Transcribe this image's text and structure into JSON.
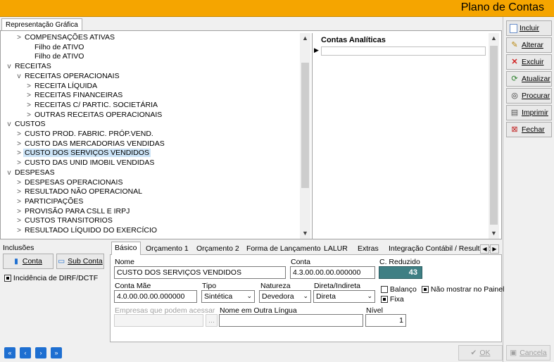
{
  "window": {
    "title": "Plano de Contas"
  },
  "main_tab": {
    "label": "Representação Gráfica"
  },
  "tree": {
    "rows": [
      {
        "label": "COMPENSAÇÕES ATIVAS",
        "chev": ">"
      },
      {
        "label": "Filho de ATIVO",
        "chev": ""
      },
      {
        "label": "Filho de ATIVO",
        "chev": ""
      },
      {
        "label": "RECEITAS",
        "chev": "v"
      },
      {
        "label": "RECEITAS OPERACIONAIS",
        "chev": "v"
      },
      {
        "label": "RECEITA LÍQUIDA",
        "chev": ">"
      },
      {
        "label": "RECEITAS FINANCEIRAS",
        "chev": ">"
      },
      {
        "label": "RECEITAS C/ PARTIC. SOCIETÁRIA",
        "chev": ">"
      },
      {
        "label": "OUTRAS RECEITAS OPERACIONAIS",
        "chev": ">"
      },
      {
        "label": "CUSTOS",
        "chev": "v"
      },
      {
        "label": "CUSTO PROD. FABRIC. PRÓP.VEND.",
        "chev": ">"
      },
      {
        "label": "CUSTO DAS MERCADORIAS VENDIDAS",
        "chev": ">"
      },
      {
        "label": "CUSTO DOS SERVIÇOS VENDIDOS",
        "chev": ">"
      },
      {
        "label": "CUSTO DAS UNID IMOBIL VENDIDAS",
        "chev": ">"
      },
      {
        "label": "DESPESAS",
        "chev": "v"
      },
      {
        "label": "DESPESAS OPERACIONAIS",
        "chev": ">"
      },
      {
        "label": "RESULTADO NÃO OPERACIONAL",
        "chev": ">"
      },
      {
        "label": "PARTICIPAÇÕES",
        "chev": ">"
      },
      {
        "label": "PROVISÃO PARA CSLL E IRPJ",
        "chev": ">"
      },
      {
        "label": "CUSTOS TRANSITORIOS",
        "chev": ">"
      },
      {
        "label": "RESULTADO LÍQUIDO DO EXERCÍCIO",
        "chev": ">"
      }
    ],
    "selected_label": "CUSTO DOS SERVIÇOS VENDIDOS"
  },
  "contas_panel": {
    "header": "Contas Analíticas"
  },
  "sidebar": {
    "incluir": "Incluir",
    "alterar": "Alterar",
    "excluir": "Excluir",
    "atualizar": "Atualizar",
    "procurar": "Procurar",
    "imprimir": "Imprimir",
    "fechar": "Fechar"
  },
  "inclusoes": {
    "label": "Inclusões",
    "conta_button": "Conta",
    "subconta_button": "Sub Conta",
    "dirf_label": "Incidência de DIRF/DCTF",
    "dirf_checked": true
  },
  "form_tabs": [
    "Básico",
    "Orçamento 1",
    "Orçamento 2",
    "Forma de Lançamento",
    "LALUR",
    "Extras",
    "Integração Contábil / Resultado"
  ],
  "form": {
    "nome_label": "Nome",
    "nome_value": "CUSTO DOS SERVIÇOS VENDIDOS",
    "conta_label": "Conta",
    "conta_value": "4.3.00.00.00.000000",
    "creduzido_label": "C. Reduzido",
    "creduzido_value": "43",
    "contamae_label": "Conta Mãe",
    "contamae_value": "4.0.00.00.00.000000",
    "tipo_label": "Tipo",
    "tipo_value": "Sintética",
    "natureza_label": "Natureza",
    "natureza_value": "Devedora",
    "direta_label": "Direta/Indireta",
    "direta_value": "Direta",
    "balanco_label": "Balanço",
    "balanco_checked": false,
    "fixa_label": "Fixa",
    "fixa_checked": true,
    "naomostrar_label": "Não mostrar no Painel",
    "naomostrar_checked": true,
    "empresas_label": "Empresas que podem acessar",
    "empresas_button": "...",
    "nomeoutra_label": "Nome em Outra Língua",
    "nivel_label": "Nível",
    "nivel_value": "1"
  },
  "footer": {
    "ok_label": "OK",
    "cancela_label": "Cancela"
  }
}
